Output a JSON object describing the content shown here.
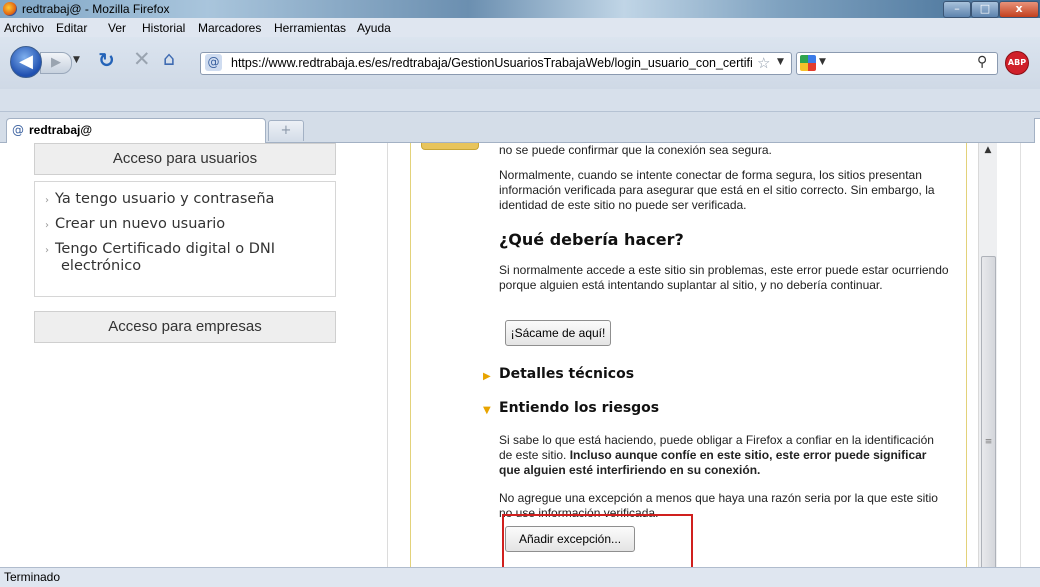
{
  "window": {
    "title": "redtrabaj@ - Mozilla Firefox"
  },
  "menu": [
    "Archivo",
    "Editar",
    "Ver",
    "Historial",
    "Marcadores",
    "Herramientas",
    "Ayuda"
  ],
  "nav": {
    "url": "https://www.redtrabaja.es/es/redtrabaja/GestionUsuariosTrabajaWeb/login_usuario_con_certifi",
    "abp_label": "ABP"
  },
  "tab": {
    "label": "redtrabaj@",
    "newtab_symbol": "+"
  },
  "sidebar": {
    "users_header": "Acceso para usuarios",
    "links": [
      "Ya tengo usuario y contraseña",
      "Crear un nuevo usuario",
      "Tengo Certificado digital o DNI",
      "electrónico"
    ],
    "companies_header": "Acceso para empresas"
  },
  "error": {
    "intro_cut": "no se puede confirmar que la conexión sea segura.",
    "para1": "Normalmente, cuando se intente conectar de forma segura, los sitios presentan información verificada para asegurar que está en el sitio correcto. Sin embargo, la identidad de este sitio no puede ser verificada.",
    "what_heading": "¿Qué debería hacer?",
    "para2": "Si normalmente accede a este sitio sin problemas, este error puede estar ocurriendo porque alguien está intentando suplantar al sitio, y no debería continuar.",
    "get_out_button": "¡Sácame de aquí!",
    "tech_heading": "Detalles técnicos",
    "risks_heading": "Entiendo los riesgos",
    "para3_plain": "Si sabe lo que está haciendo, puede obligar a Firefox a confiar en la identificación de este sitio. ",
    "para3_bold": "Incluso aunque confíe en este sitio, este error puede significar que alguien esté interfiriendo en su conexión.",
    "para4": "No agregue una excepción a menos que haya una razón seria por la que este sitio no use información verificada.",
    "add_exception_button": "Añadir excepción..."
  },
  "status": {
    "text": "Terminado"
  },
  "colors": {
    "highlight": "#d0201e",
    "warning": "#e8a400",
    "panel_border": "#e3d27a"
  }
}
